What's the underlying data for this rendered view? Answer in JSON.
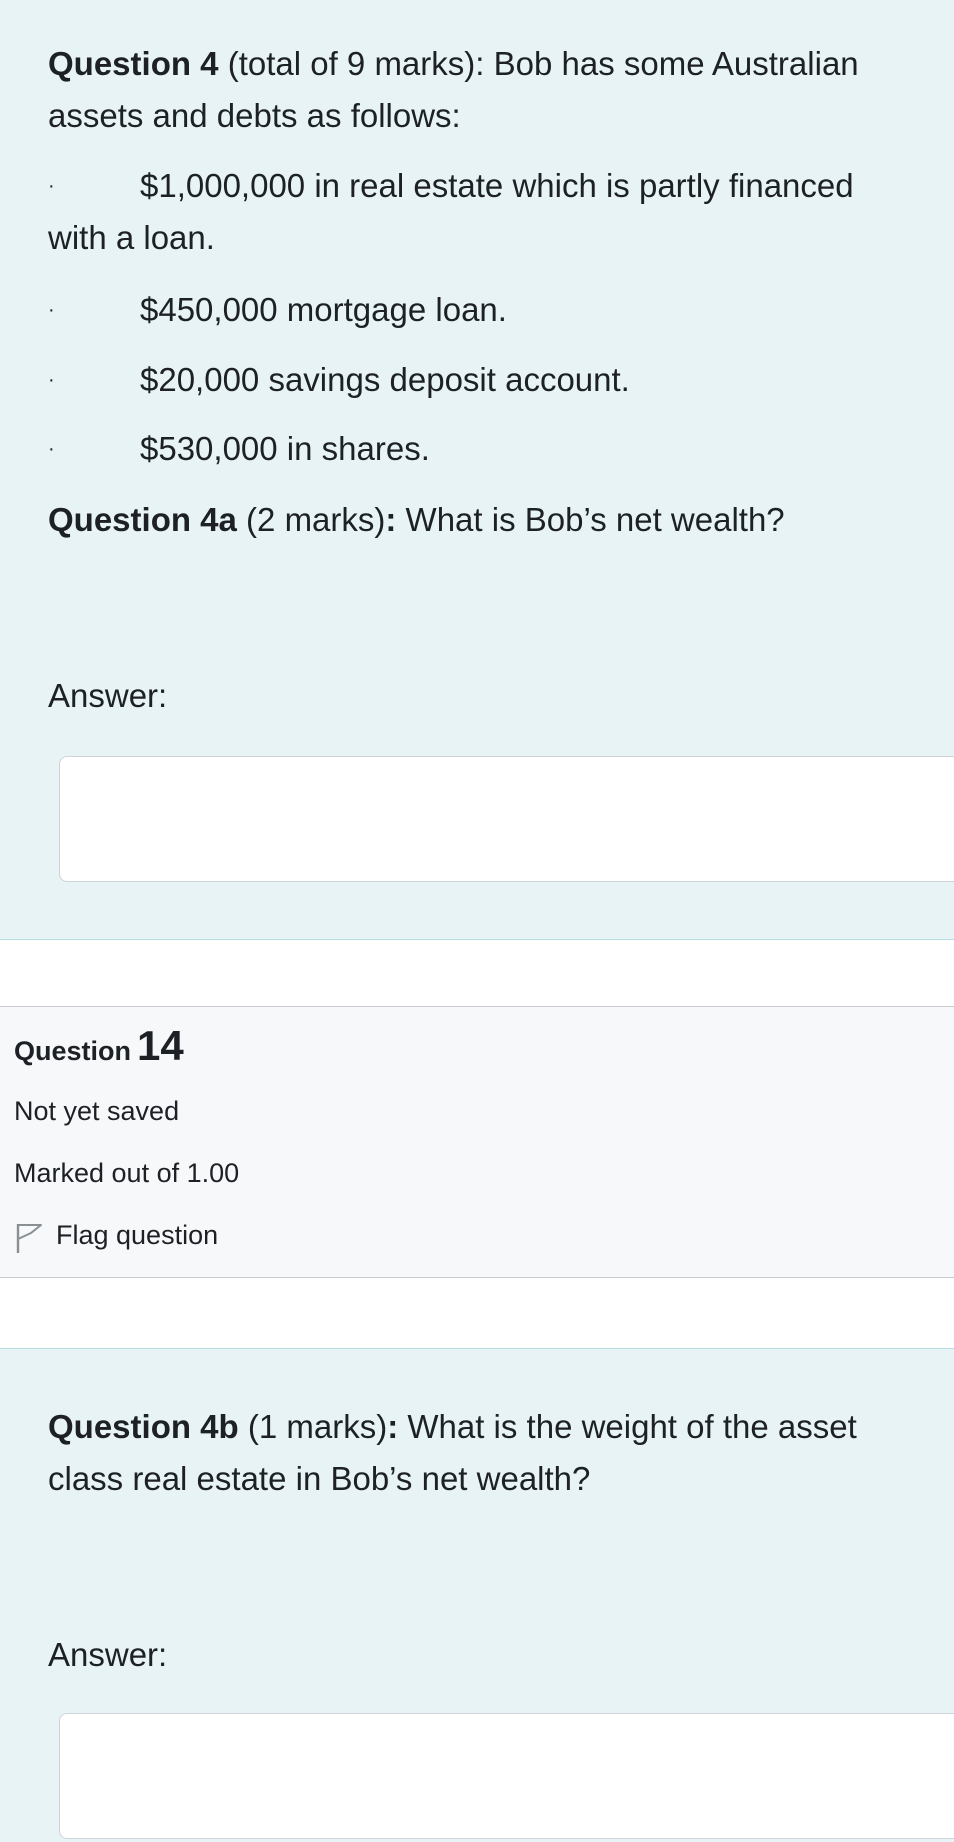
{
  "question4": {
    "intro_bold": "Question 4",
    "intro_rest": " (total of 9 marks): Bob has some Australian assets and debts as follows:",
    "bullets": [
      "$1,000,000 in real estate which is partly financed",
      "$450,000 mortgage loan.",
      "$20,000 savings deposit account.",
      "$530,000 in shares."
    ],
    "bullet1_continuation": "with a loan.",
    "bullet_symbol": "·",
    "q4a_bold": "Question 4a",
    "q4a_marks": " (2 marks)",
    "q4a_colon": ":",
    "q4a_rest": " What is Bob’s net wealth?",
    "answer_label": "Answer:",
    "answer_value": ""
  },
  "question_info": {
    "label": "Question",
    "number": "14",
    "status": "Not yet saved",
    "marks": "Marked out of 1.00",
    "flag_label": "Flag question",
    "flag_icon": "flag-icon"
  },
  "question4b": {
    "q4b_bold": "Question 4b",
    "q4b_marks": " (1 marks)",
    "q4b_colon": ":",
    "q4b_rest": " What is the weight of the asset class real estate in Bob’s net wealth?",
    "answer_label": "Answer:",
    "answer_value": ""
  }
}
